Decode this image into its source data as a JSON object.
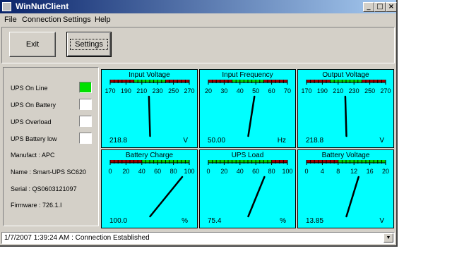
{
  "window": {
    "title": "WinNutClient"
  },
  "menu": [
    "File",
    "Connection",
    "Settings",
    "Help"
  ],
  "toolbar": {
    "exit_label": "Exit",
    "settings_label": "Settings"
  },
  "status": {
    "indicators": [
      {
        "label": "UPS On Line",
        "active": true
      },
      {
        "label": "UPS On Battery",
        "active": false
      },
      {
        "label": "UPS Overload",
        "active": false
      },
      {
        "label": "UPS Battery low",
        "active": false
      }
    ],
    "manufact": "Manufact : APC",
    "name": "Name : Smart-UPS SC620",
    "serial": "Serial : QS0603121097",
    "firmware": "Firmware : 726.1.I"
  },
  "gauges": [
    {
      "title": "Input Voltage",
      "ticks": [
        "170",
        "190",
        "210",
        "230",
        "250",
        "270"
      ],
      "min": 170,
      "max": 270,
      "value": 218.8,
      "value_text": "218.8",
      "unit": "V",
      "zones": [
        [
          "red",
          0,
          0.3
        ],
        [
          "green",
          0.3,
          0.7
        ],
        [
          "red",
          0.7,
          1
        ]
      ]
    },
    {
      "title": "Input Frequency",
      "ticks": [
        "20",
        "30",
        "40",
        "50",
        "60",
        "70"
      ],
      "min": 20,
      "max": 70,
      "value": 50.0,
      "value_text": "50.00",
      "unit": "Hz",
      "zones": [
        [
          "red",
          0,
          0.3
        ],
        [
          "green",
          0.3,
          0.7
        ],
        [
          "red",
          0.7,
          1
        ]
      ]
    },
    {
      "title": "Output Voltage",
      "ticks": [
        "170",
        "190",
        "210",
        "230",
        "250",
        "270"
      ],
      "min": 170,
      "max": 270,
      "value": 218.8,
      "value_text": "218.8",
      "unit": "V",
      "zones": [
        [
          "red",
          0,
          0.3
        ],
        [
          "green",
          0.3,
          0.7
        ],
        [
          "red",
          0.7,
          1
        ]
      ]
    },
    {
      "title": "Battery Charge",
      "ticks": [
        "0",
        "20",
        "40",
        "60",
        "80",
        "100"
      ],
      "min": 0,
      "max": 100,
      "value": 100.0,
      "value_text": "100.0",
      "unit": "%",
      "zones": [
        [
          "red",
          0,
          0.4
        ],
        [
          "green",
          0.4,
          1
        ]
      ]
    },
    {
      "title": "UPS Load",
      "ticks": [
        "0",
        "20",
        "40",
        "60",
        "80",
        "100"
      ],
      "min": 0,
      "max": 100,
      "value": 75.4,
      "value_text": "75.4",
      "unit": "%",
      "zones": [
        [
          "green",
          0,
          0.8
        ],
        [
          "red",
          0.8,
          1
        ]
      ]
    },
    {
      "title": "Battery Voltage",
      "ticks": [
        "0",
        "4",
        "8",
        "12",
        "16",
        "20"
      ],
      "min": 0,
      "max": 20,
      "value": 13.85,
      "value_text": "13.85",
      "unit": "V",
      "zones": [
        [
          "red",
          0,
          0.4
        ],
        [
          "green",
          0.4,
          1
        ]
      ]
    }
  ],
  "statusbar": {
    "text": "1/7/2007 1:39:24 AM : Connection Established"
  },
  "colors": {
    "gauge_bg": "#00ffff",
    "zone_red": "#a00000",
    "zone_green": "#00d000",
    "indicator_on": "#00e000"
  }
}
